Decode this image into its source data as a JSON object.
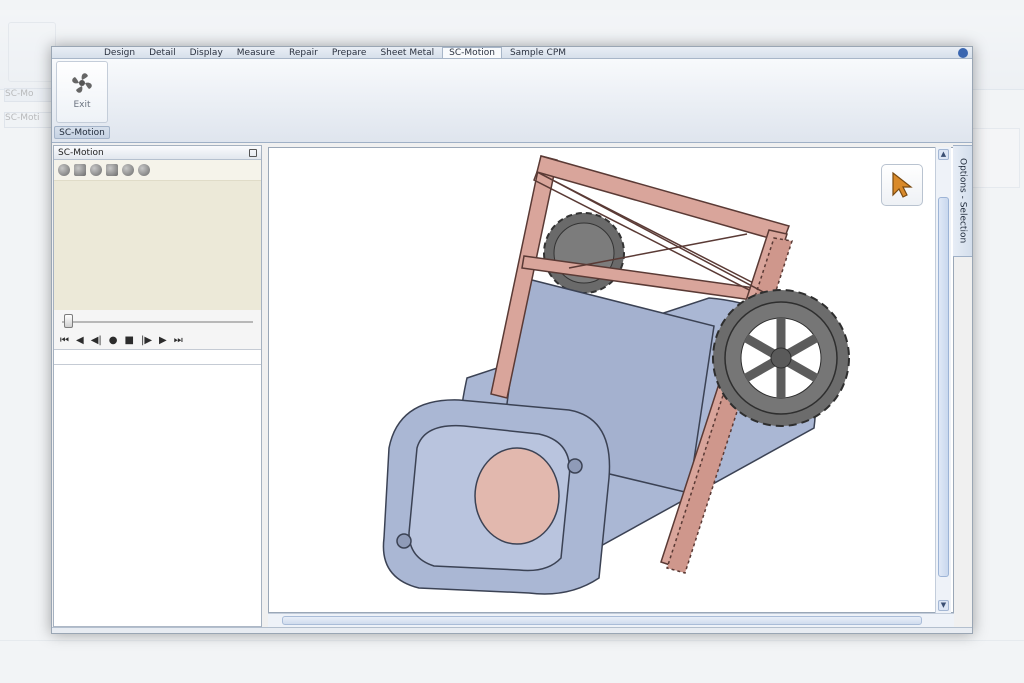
{
  "background_window": {
    "group_label": "SC-Mo",
    "sub_label": "SC-Moti"
  },
  "tabs": [
    {
      "label": "Design"
    },
    {
      "label": "Detail"
    },
    {
      "label": "Display"
    },
    {
      "label": "Measure"
    },
    {
      "label": "Repair"
    },
    {
      "label": "Prepare"
    },
    {
      "label": "Sheet Metal"
    },
    {
      "label": "SC-Motion"
    },
    {
      "label": "Sample CPM"
    }
  ],
  "active_tab": "SC-Motion",
  "ribbon": {
    "exit_label": "Exit",
    "group_label": "SC-Motion",
    "exit_icon": "fan-icon"
  },
  "panel": {
    "title": "SC-Motion",
    "pin_icon": "pin-icon",
    "transport": [
      "⏮",
      "◀",
      "◀|",
      "●",
      "■",
      "|▶",
      "▶",
      "⏭"
    ]
  },
  "viewport": {
    "tool_icon": "arrow-pointer-icon"
  },
  "side_tab": {
    "label": "Options - Selection"
  },
  "colors": {
    "frame": "#d9a59b",
    "housing": "#a9b6d3",
    "gear": "#6e6e6e",
    "accent": "#3a66b0"
  }
}
